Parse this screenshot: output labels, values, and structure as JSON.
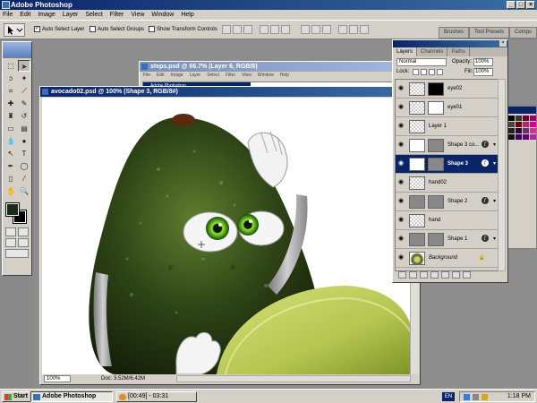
{
  "app": {
    "title": "Adobe Photoshop",
    "window_buttons": [
      "_",
      "□",
      "×"
    ]
  },
  "menu": [
    {
      "label": "File"
    },
    {
      "label": "Edit"
    },
    {
      "label": "Image"
    },
    {
      "label": "Layer"
    },
    {
      "label": "Select"
    },
    {
      "label": "Filter"
    },
    {
      "label": "View"
    },
    {
      "label": "Window"
    },
    {
      "label": "Help"
    }
  ],
  "options": {
    "auto_select_layer": "Auto Select Layer",
    "auto_select_groups": "Auto Select Groups",
    "show_transform_controls": "Show Transform Controls",
    "auto_select_layer_checked": true,
    "auto_select_groups_checked": false,
    "show_transform_checked": false
  },
  "well_tabs": [
    "Brushes",
    "Tool Presets",
    "Comps"
  ],
  "documents": {
    "steps": {
      "title": "steps.psd @ 66.7% (Layer 6, RGB/8)",
      "inner_title": "Adobe Photoshop"
    },
    "avocado": {
      "title": "avocado02.psd @ 100% (Shape 3, RGB/8#)",
      "zoom": "100%",
      "doc_size": "Doc: 3.52M/6.42M"
    }
  },
  "layers_panel": {
    "tabs": [
      "Layers",
      "Channels",
      "Paths"
    ],
    "blend_mode": "Normal",
    "opacity_label": "Opacity:",
    "opacity": "100%",
    "lock_label": "Lock:",
    "fill_label": "Fill:",
    "fill": "100%",
    "layers": [
      {
        "name": "eye02",
        "thumb": "checker",
        "mask": "black",
        "fx": false,
        "selected": false
      },
      {
        "name": "eye01",
        "thumb": "checker",
        "mask": "white",
        "fx": false,
        "selected": false
      },
      {
        "name": "Layer 1",
        "thumb": "checker",
        "mask": null,
        "fx": false,
        "selected": false
      },
      {
        "name": "Shape 3 co...",
        "thumb": "white",
        "mask": "gray",
        "fx": true,
        "selected": false
      },
      {
        "name": "Shape 3",
        "thumb": "white",
        "mask": "gray",
        "fx": true,
        "selected": true
      },
      {
        "name": "hand02",
        "thumb": "checker",
        "mask": null,
        "fx": false,
        "selected": false
      },
      {
        "name": "Shape 2",
        "thumb": "gray",
        "mask": "gray",
        "fx": true,
        "selected": false
      },
      {
        "name": "hand",
        "thumb": "checker",
        "mask": null,
        "fx": false,
        "selected": false
      },
      {
        "name": "Shape 1",
        "thumb": "gray",
        "mask": "gray",
        "fx": true,
        "selected": false
      },
      {
        "name": "Background",
        "thumb": "avocado",
        "mask": null,
        "fx": false,
        "selected": false,
        "locked": true
      }
    ]
  },
  "taskbar": {
    "start": "Start",
    "tasks": [
      {
        "label": "Adobe Photoshop",
        "icon": "photoshop-icon",
        "active": true
      },
      {
        "label": "[00:49] - 03:31",
        "icon": "media-player-icon",
        "active": false
      }
    ],
    "language": "EN",
    "clock": "1:18 PM"
  }
}
